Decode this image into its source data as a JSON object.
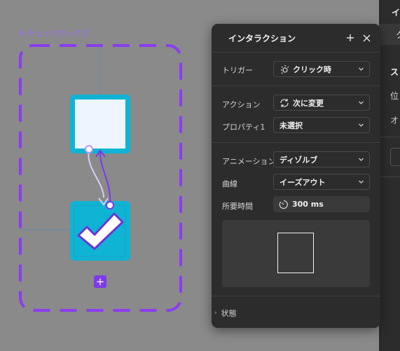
{
  "canvas": {
    "component_label": "チェックボックス",
    "add_label": "+"
  },
  "dialog": {
    "title": "インタラクション",
    "trigger": {
      "label": "トリガー",
      "value": "クリック時"
    },
    "action": {
      "label": "アクション",
      "value": "次に変更"
    },
    "property": {
      "label": "プロパティ1",
      "value": "未選択"
    },
    "animation": {
      "label": "アニメーション",
      "value": "ディゾルブ"
    },
    "curve": {
      "label": "曲線",
      "value": "イーズアウト"
    },
    "duration": {
      "label": "所要時間",
      "value": "300 ms"
    },
    "state": {
      "label": "状態"
    }
  },
  "right_panel": {
    "header": "イ",
    "tab": "ク",
    "section": "ス",
    "row1": "位",
    "row2": "オ"
  },
  "colors": {
    "accent_purple": "#8b3cf0",
    "cyan": "#0fb3d4",
    "panel_bg": "#2c2c2c",
    "canvas_bg": "#8a8a8a"
  }
}
